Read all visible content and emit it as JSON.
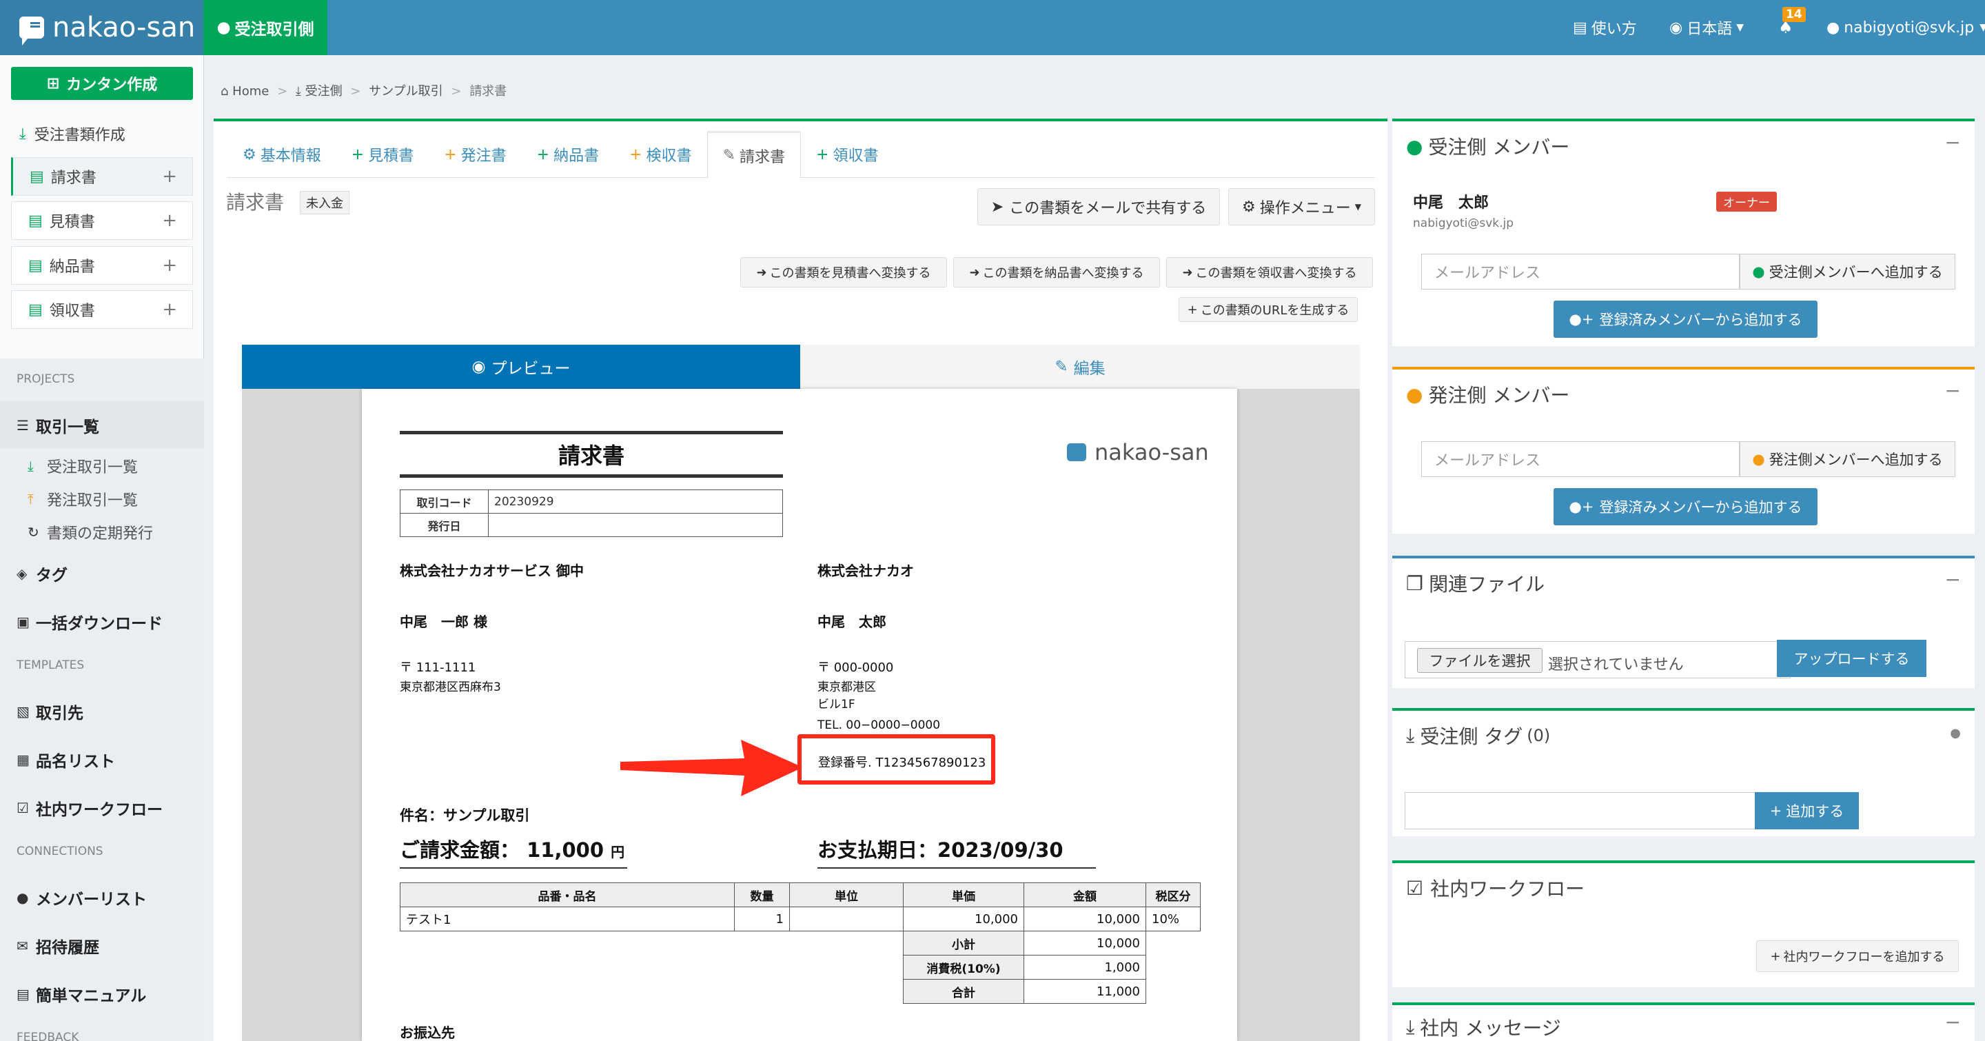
{
  "header": {
    "brand": "nakao-san",
    "role_tab": "受注取引側",
    "help": "使い方",
    "language": "日本語",
    "notif_count": "14",
    "user": "nabigyoti@svk.jp"
  },
  "sidebar": {
    "create_button": "カンタン作成",
    "doc_section": "受注書類作成",
    "docs": [
      "請求書",
      "見積書",
      "納品書",
      "領収書"
    ],
    "projects_heading": "PROJECTS",
    "deals": "取引一覧",
    "deals_sub": [
      "受注取引一覧",
      "発注取引一覧",
      "書類の定期発行"
    ],
    "tags": "タグ",
    "bulk_download": "一括ダウンロード",
    "templates_heading": "TEMPLATES",
    "clients": "取引先",
    "items": "品名リスト",
    "workflow": "社内ワークフロー",
    "connections_heading": "CONNECTIONS",
    "members": "メンバーリスト",
    "invites": "招待履歴",
    "manual": "簡単マニュアル",
    "feedback_heading": "FEEDBACK"
  },
  "breadcrumb": [
    "Home",
    "受注側",
    "サンプル取引",
    "請求書"
  ],
  "tabs": [
    "基本情報",
    "見積書",
    "発注書",
    "納品書",
    "検収書",
    "請求書",
    "領収書"
  ],
  "doc": {
    "title": "請求書",
    "status": "未入金",
    "share": "この書類をメールで共有する",
    "ops": "操作メニュー"
  },
  "convert_buttons": [
    "この書類を見積書へ変換する",
    "この書類を納品書へ変換する",
    "この書類を領収書へ変換する",
    "この書類のURLを生成する"
  ],
  "view_tabs": {
    "preview": "プレビュー",
    "edit": "編集"
  },
  "invoice": {
    "title": "請求書",
    "logo": "nakao-san",
    "code_label": "取引コード",
    "code": "20230929",
    "date_label": "発行日",
    "date": "",
    "to_company": "株式会社ナカオサービス 御中",
    "to_person": "中尾　一郎 様",
    "to_zip": "〒 111-1111",
    "to_addr": "東京都港区西麻布3",
    "from_company": "株式会社ナカオ",
    "from_person": "中尾　太郎",
    "from_zip": "〒 000-0000",
    "from_addr1": "東京都港区",
    "from_addr2": "ビル1F",
    "from_tel": "TEL. 00−0000−0000",
    "reg_no": "登録番号. T1234567890123",
    "subject": "件名：サンプル取引",
    "amount_label": "ご請求金額：",
    "amount": "11,000",
    "yen": "円",
    "due": "お支払期日：2023/09/30",
    "cols": [
      "品番・品名",
      "数量",
      "単位",
      "単価",
      "金額",
      "税区分"
    ],
    "rows": [
      [
        "テスト1",
        "1",
        "",
        "10,000",
        "10,000",
        "10%"
      ]
    ],
    "subtotal_label": "小計",
    "subtotal": "10,000",
    "tax_label": "消費税(10%)",
    "tax": "1,000",
    "total_label": "合計",
    "total": "11,000",
    "bank_label": "お振込先"
  },
  "panels": {
    "recv": {
      "title": "受注側 メンバー",
      "name": "中尾　太郎",
      "owner": "オーナー",
      "email": "nabigyoti@svk.jp",
      "placeholder": "メールアドレス",
      "add": "受注側メンバーへ追加する",
      "add_reg": "登録済みメンバーから追加する"
    },
    "order": {
      "title": "発注側 メンバー",
      "placeholder": "メールアドレス",
      "add": "発注側メンバーへ追加する",
      "add_reg": "登録済みメンバーから追加する"
    },
    "files": {
      "title": "関連ファイル",
      "choose": "ファイルを選択",
      "none": "選択されていません",
      "upload": "アップロードする"
    },
    "tags": {
      "title": "受注側 タグ",
      "count": "(0)",
      "add": "追加する"
    },
    "workflow": {
      "title": "社内ワークフロー",
      "add": "社内ワークフローを追加する"
    },
    "messages": {
      "title": "社内 メッセージ"
    }
  },
  "colors": {
    "header": "#3c8dbc",
    "green": "#00a65a",
    "orange": "#f39c12",
    "red_highlight": "#ff2a1a"
  }
}
